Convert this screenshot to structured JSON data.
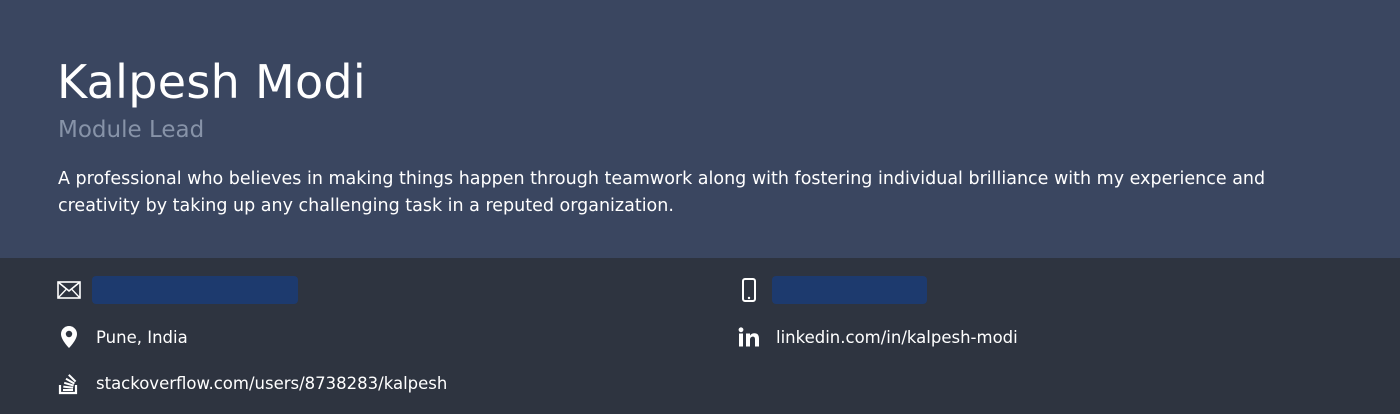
{
  "profile": {
    "name": "Kalpesh Modi",
    "role": "Module Lead",
    "summary": "A professional who believes in making things happen through teamwork along with fostering individual brilliance with my experience and creativity by taking up any challenging task in a reputed organization."
  },
  "contacts": {
    "email": {
      "icon": "email-icon",
      "value": ""
    },
    "phone": {
      "icon": "phone-icon",
      "value": ""
    },
    "location": {
      "icon": "location-pin-icon",
      "value": "Pune, India"
    },
    "linkedin": {
      "icon": "linkedin-icon",
      "value": "linkedin.com/in/kalpesh-modi"
    },
    "stackoverflow": {
      "icon": "stackoverflow-icon",
      "value": "stackoverflow.com/users/8738283/kalpesh"
    }
  },
  "colors": {
    "header_bg": "#3a4660",
    "contacts_bg": "#2e3440",
    "role_text": "#8793a8",
    "redaction": "#1d3a6e"
  }
}
